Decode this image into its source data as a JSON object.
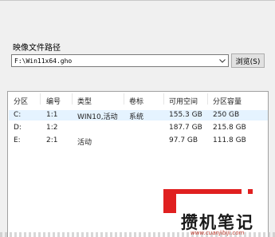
{
  "image_file_section": {
    "label": "映像文件路径",
    "path_value": "F:\\Win11x64.gho",
    "browse_button": "浏览(S)"
  },
  "partition_list": {
    "columns": [
      "分区",
      "编号",
      "类型",
      "卷标",
      "可用空间",
      "分区容量"
    ],
    "rows": [
      {
        "partition": "C:",
        "number": "1:1",
        "type": "WIN10,活动",
        "label": "系统",
        "free": "155.3 GB",
        "capacity": "250 GB",
        "selected": true
      },
      {
        "partition": "D:",
        "number": "1:2",
        "type": "",
        "label": "",
        "free": "187.7 GB",
        "capacity": "215.8 GB",
        "selected": false
      },
      {
        "partition": "E:",
        "number": "2:1",
        "type": "活动",
        "label": "",
        "free": "97.7 GB",
        "capacity": "111.8 GB",
        "selected": false
      }
    ]
  },
  "watermark": {
    "brand": "攒机笔记",
    "url": "www.cuanjibiji.com",
    "accent_color": "#e02020"
  }
}
